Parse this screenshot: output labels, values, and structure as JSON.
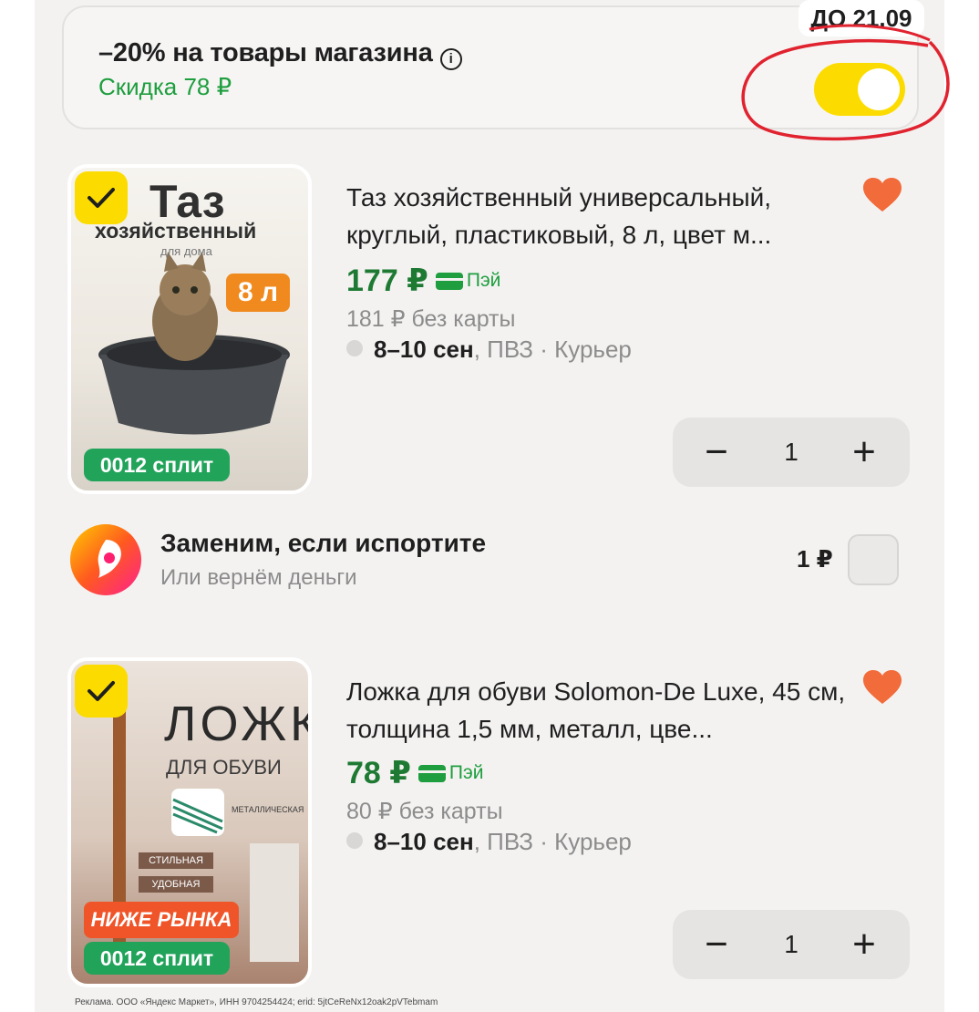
{
  "promo": {
    "title": "–20% на товары магазина",
    "info_glyph": "i",
    "subtitle": "Скидка 78 ₽",
    "deadline": "ДО 21.09",
    "toggle_on": true
  },
  "products": [
    {
      "title": "Таз хозяйственный универсальный, круглый, пластиковый, 8 л, цвет м...",
      "price": "177 ₽",
      "pay_label": "Пэй",
      "old_price": "181 ₽ без карты",
      "delivery_date": "8–10 сен",
      "delivery_rest": ", ПВЗ · Курьер",
      "quantity": "1",
      "minus": "−",
      "plus": "+",
      "image": {
        "title_big": "Таз",
        "title_small": "хозяйственный",
        "caption": "для дома",
        "tag": "8 л",
        "split": "0012 сплит"
      }
    },
    {
      "title": "Ложка для обуви Solomon-De Luxe, 45 см, толщина 1,5 мм, металл, цве...",
      "price": "78 ₽",
      "pay_label": "Пэй",
      "old_price": "80 ₽ без карты",
      "delivery_date": "8–10 сен",
      "delivery_rest": ", ПВЗ · Курьер",
      "quantity": "1",
      "minus": "−",
      "plus": "+",
      "image": {
        "title_big": "ЛОЖКА",
        "title_small": "ДЛЯ ОБУВИ",
        "caption": "МЕТАЛЛИЧЕСКАЯ",
        "tag1": "СТИЛЬНАЯ",
        "tag2": "УДОБНАЯ",
        "tag": "НИЖЕ РЫНКА",
        "split": "0012 сплит"
      }
    }
  ],
  "insurance": {
    "title": "Заменим, если испортите",
    "subtitle": "Или вернём деньги",
    "price": "1 ₽"
  },
  "footer": {
    "ad_text": "Реклама. ООО «Яндекс Маркет», ИНН 9704254424; erid: 5jtCeReNx12oak2pVTebmam"
  },
  "colors": {
    "accent_yellow": "#fcdc00",
    "price_green": "#1e7a33",
    "discount_green": "#1e9e3e",
    "heart": "#f26b3a",
    "annotation_red": "#e0232f"
  }
}
